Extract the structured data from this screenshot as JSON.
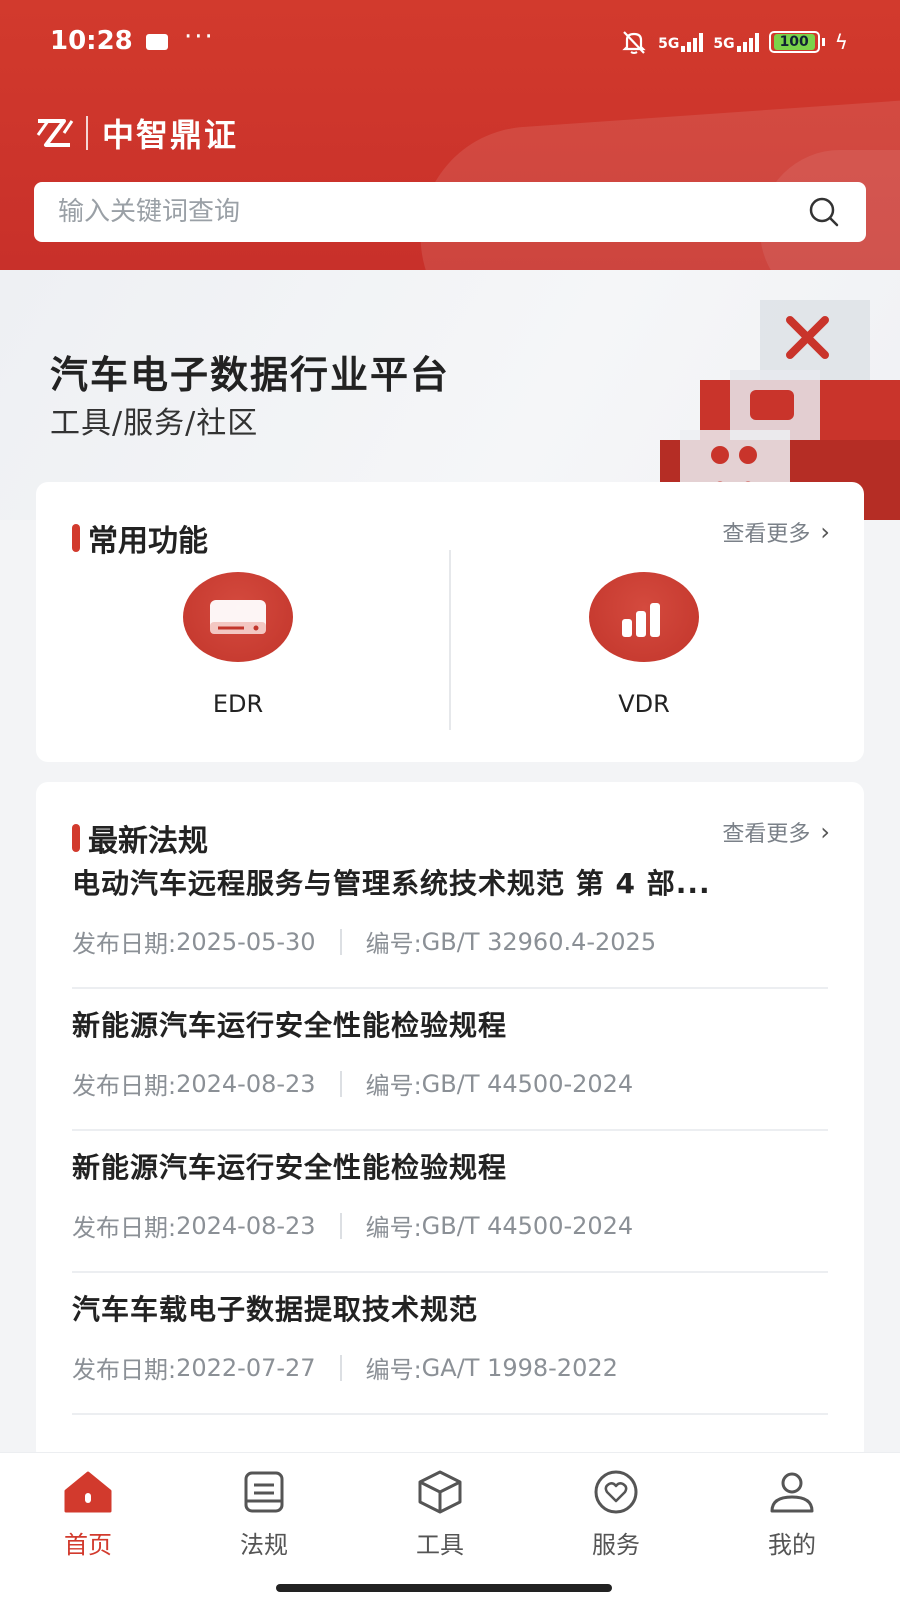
{
  "status": {
    "time": "10:28",
    "more": "···",
    "signal1": "5G",
    "signal2": "5G",
    "battery": "100"
  },
  "brand": {
    "name": "中智鼎证"
  },
  "search": {
    "placeholder": "输入关键词查询"
  },
  "banner": {
    "title": "汽车电子数据行业平台",
    "subtitle": "工具/服务/社区"
  },
  "common": {
    "title": "常用功能",
    "more": "查看更多",
    "items": [
      {
        "label": "EDR"
      },
      {
        "label": "VDR"
      }
    ]
  },
  "laws": {
    "title": "最新法规",
    "more": "查看更多",
    "date_label": "发布日期: ",
    "code_label": "编号: ",
    "items": [
      {
        "title": "电动汽车远程服务与管理系统技术规范 第 4 部...",
        "date": "2025-05-30",
        "code": "GB/T 32960.4-2025"
      },
      {
        "title": "新能源汽车运行安全性能检验规程",
        "date": "2024-08-23",
        "code": "GB/T 44500-2024"
      },
      {
        "title": "新能源汽车运行安全性能检验规程",
        "date": "2024-08-23",
        "code": "GB/T 44500-2024"
      },
      {
        "title": "汽车车载电子数据提取技术规范",
        "date": "2022-07-27",
        "code": "GA/T 1998-2022"
      }
    ]
  },
  "tabs": [
    {
      "label": "首页",
      "icon": "home-icon",
      "active": true
    },
    {
      "label": "法规",
      "icon": "document-icon",
      "active": false
    },
    {
      "label": "工具",
      "icon": "box-icon",
      "active": false
    },
    {
      "label": "服务",
      "icon": "heart-icon",
      "active": false
    },
    {
      "label": "我的",
      "icon": "user-icon",
      "active": false
    }
  ],
  "colors": {
    "brand": "#d23a2d",
    "background": "#f3f4f6"
  }
}
